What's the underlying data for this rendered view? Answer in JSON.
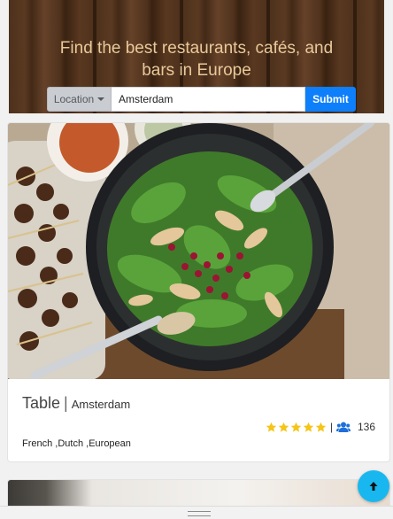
{
  "hero": {
    "title": "Find the best restaurants, cafés, and bars in Europe",
    "location_label": "Location",
    "location_value": "Amsterdam",
    "submit_label": "Submit"
  },
  "restaurant": {
    "name": "Table",
    "separator": "|",
    "city": "Amsterdam",
    "rating_stars": 5,
    "rating_separator": "|",
    "review_count": "136",
    "cuisines": "French ,Dutch ,European"
  },
  "icons": {
    "star": "star-icon",
    "reviewers": "users-icon",
    "scroll_top": "arrow-up-icon",
    "dropdown": "caret-down-icon"
  },
  "colors": {
    "accent": "#0d7ffb",
    "star": "#f5c518",
    "reviewers_icon": "#1e6fd9",
    "scroll_top": "#19b7f0"
  }
}
